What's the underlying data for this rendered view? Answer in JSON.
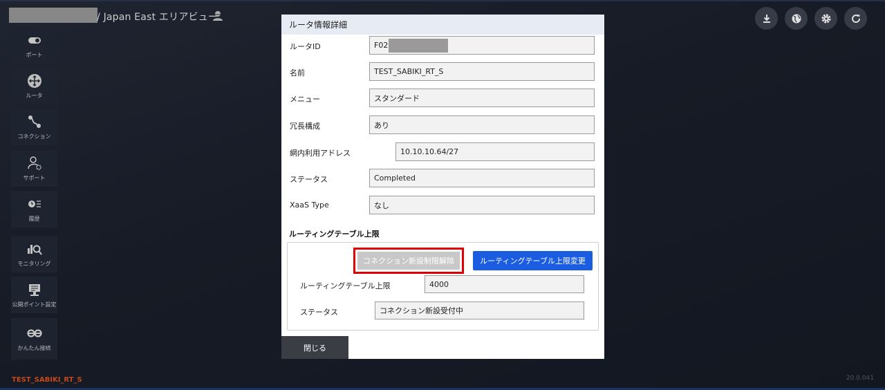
{
  "header": {
    "title": "/ Japan East エリアビュー"
  },
  "toolbar": {
    "download_icon": "download-icon",
    "globe_icon": "globe-icon",
    "settings_icon": "gear-icon",
    "refresh_icon": "refresh-icon"
  },
  "sidebar": {
    "items": [
      {
        "label": "ポート",
        "icon": "port-icon"
      },
      {
        "label": "ルータ",
        "icon": "router-icon"
      },
      {
        "label": "コネクション",
        "icon": "connection-icon"
      },
      {
        "label": "サポート",
        "icon": "support-icon"
      },
      {
        "label": "履歴",
        "icon": "history-icon"
      },
      {
        "label": "モニタリング",
        "icon": "monitoring-icon"
      },
      {
        "label": "公開ポイント設定",
        "icon": "monitor-icon"
      },
      {
        "label": "かんたん接続",
        "icon": "easy-connect-icon"
      }
    ]
  },
  "footer": {
    "router_name": "TEST_SABIKI_RT_S",
    "version": "20.0.041"
  },
  "modal": {
    "title": "ルータ情報詳細",
    "fields": {
      "router_id_label": "ルータID",
      "router_id_value": "F02",
      "name_label": "名前",
      "name_value": "TEST_SABIKI_RT_S",
      "menu_label": "メニュー",
      "menu_value": "スタンダード",
      "redundancy_label": "冗長構成",
      "redundancy_value": "あり",
      "address_label": "網内利用アドレス",
      "address_value": "10.10.10.64/27",
      "status_label": "ステータス",
      "status_value": "Completed",
      "xaas_label": "XaaS Type",
      "xaas_value": "なし"
    },
    "routing": {
      "section_title": "ルーティングテーブル上限",
      "release_button": "コネクション新設制限解除",
      "change_button": "ルーティングテーブル上限変更",
      "limit_label": "ルーティングテーブル上限",
      "limit_value": "4000",
      "status_label": "ステータス",
      "status_value": "コネクション新設受付中"
    },
    "close_button": "閉じる"
  }
}
